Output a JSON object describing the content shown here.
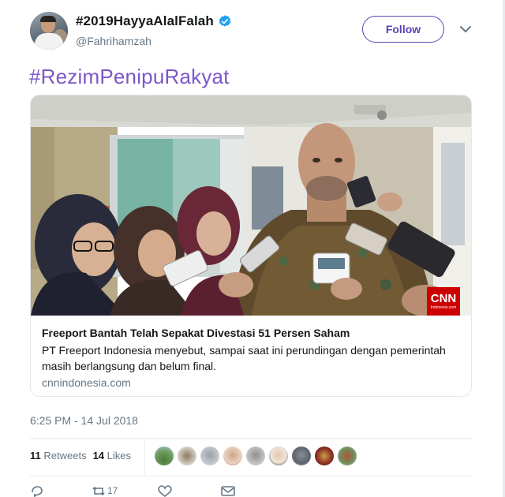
{
  "user": {
    "display_name": "#2019HayyaAlalFalah",
    "handle": "@Fahrihamzah"
  },
  "follow_label": "Follow",
  "tweet": {
    "hashtag": "#RezimPenipuRakyat",
    "timestamp": "6:25 PM - 14 Jul 2018"
  },
  "card": {
    "title": "Freeport Bantah Telah Sepakat Divestasi 51 Persen Saham",
    "description": "PT Freeport Indonesia menyebut, sampai saat ini perundingan dengan pemerintah masih berlangsung dan belum final.",
    "domain": "cnnindonesia.com",
    "logo_text": "CNN",
    "logo_sub": "Indonesia.com"
  },
  "stats": {
    "retweets_count": "11",
    "retweets_label": "Retweets",
    "likes_count": "14",
    "likes_label": "Likes"
  },
  "actions": {
    "retweet_count": "17",
    "like_count": ""
  },
  "colors": {
    "accent": "#5b41b3",
    "hashtag": "#7a57c8",
    "verified": "#1da1f2",
    "cnn_red": "#cc0000"
  },
  "icons": [
    "verified-badge-icon",
    "chevron-down-icon",
    "reply-icon",
    "retweet-icon",
    "like-icon",
    "dm-icon"
  ]
}
